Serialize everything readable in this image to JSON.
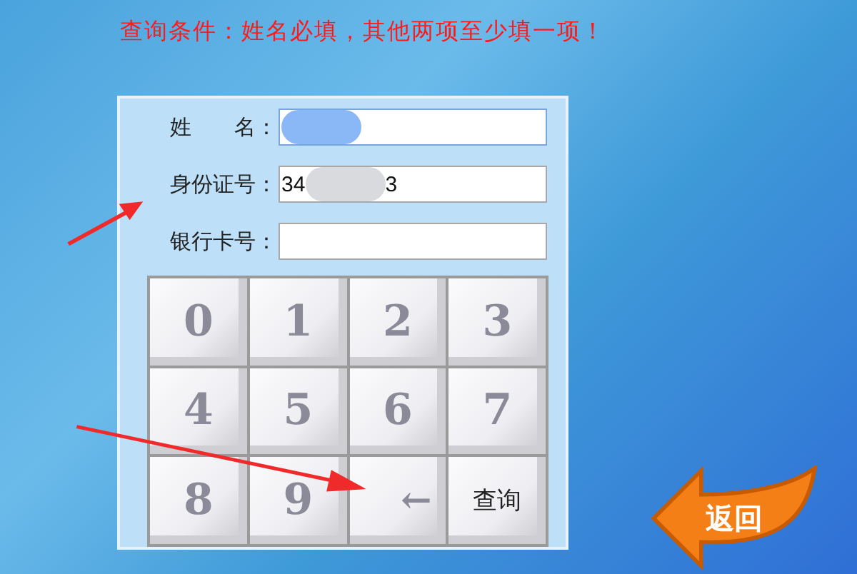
{
  "notice": "查询条件：姓名必填，其他两项至少填一项！",
  "fields": [
    {
      "label": "姓　　名：",
      "redacted": true,
      "focused": true
    },
    {
      "label": "身份证号：",
      "value_start": "34",
      "value_end": "3",
      "redacted": true,
      "focused": false
    },
    {
      "label": "银行卡号：",
      "redacted": false,
      "focused": false
    }
  ],
  "keypad": [
    {
      "label": "0",
      "kind": "digit"
    },
    {
      "label": "1",
      "kind": "digit"
    },
    {
      "label": "2",
      "kind": "digit"
    },
    {
      "label": "3",
      "kind": "digit"
    },
    {
      "label": "4",
      "kind": "digit"
    },
    {
      "label": "5",
      "kind": "digit"
    },
    {
      "label": "6",
      "kind": "digit"
    },
    {
      "label": "7",
      "kind": "digit"
    },
    {
      "label": "8",
      "kind": "digit"
    },
    {
      "label": "9",
      "kind": "digit"
    },
    {
      "label": "←",
      "kind": "backspace"
    },
    {
      "label": "查询",
      "kind": "submit"
    }
  ],
  "back_button": {
    "label": "返回"
  }
}
